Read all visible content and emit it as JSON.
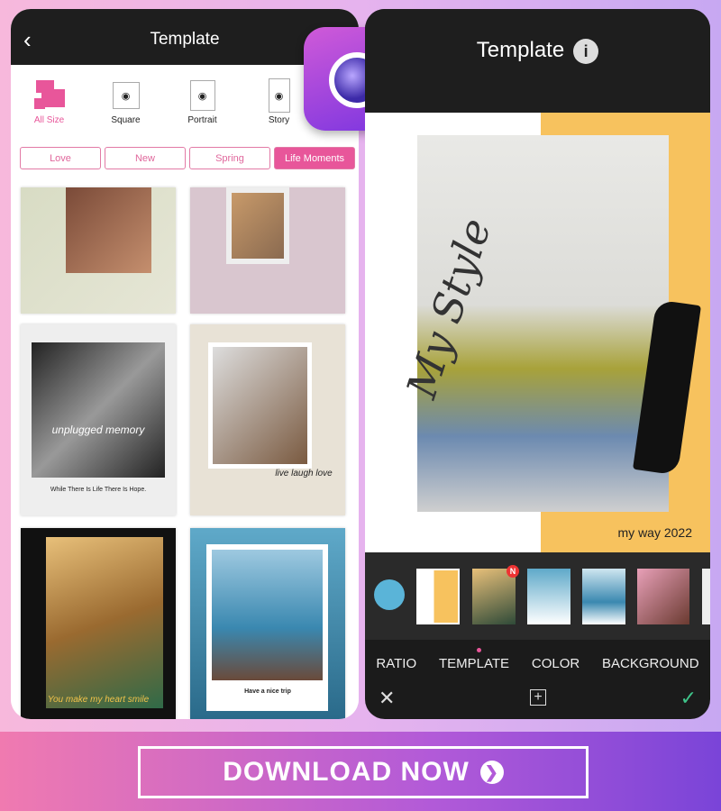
{
  "left": {
    "title": "Template",
    "sizes": [
      {
        "label": "All Size"
      },
      {
        "label": "Square"
      },
      {
        "label": "Portrait"
      },
      {
        "label": "Story"
      }
    ],
    "chips": [
      "Love",
      "New",
      "Spring",
      "Life Moments"
    ],
    "selected_chip": "Life Moments",
    "tile_texts": {
      "hope": "While There Is Life There Is Hope.",
      "trip": "Have a nice trip",
      "unplugged": "unplugged memory",
      "live": "live laugh love",
      "smile": "You make my heart smile"
    }
  },
  "right": {
    "title": "Template",
    "canvas_script": "My Style",
    "canvas_caption": "my way  2022",
    "tabs": [
      "RATIO",
      "TEMPLATE",
      "COLOR",
      "BACKGROUND"
    ],
    "active_tab": "TEMPLATE",
    "new_badge": "N"
  },
  "cta": {
    "label": "DOWNLOAD NOW"
  },
  "colors": {
    "accent": "#e8569a",
    "yellow": "#f7c25e",
    "check": "#3fc48a"
  }
}
